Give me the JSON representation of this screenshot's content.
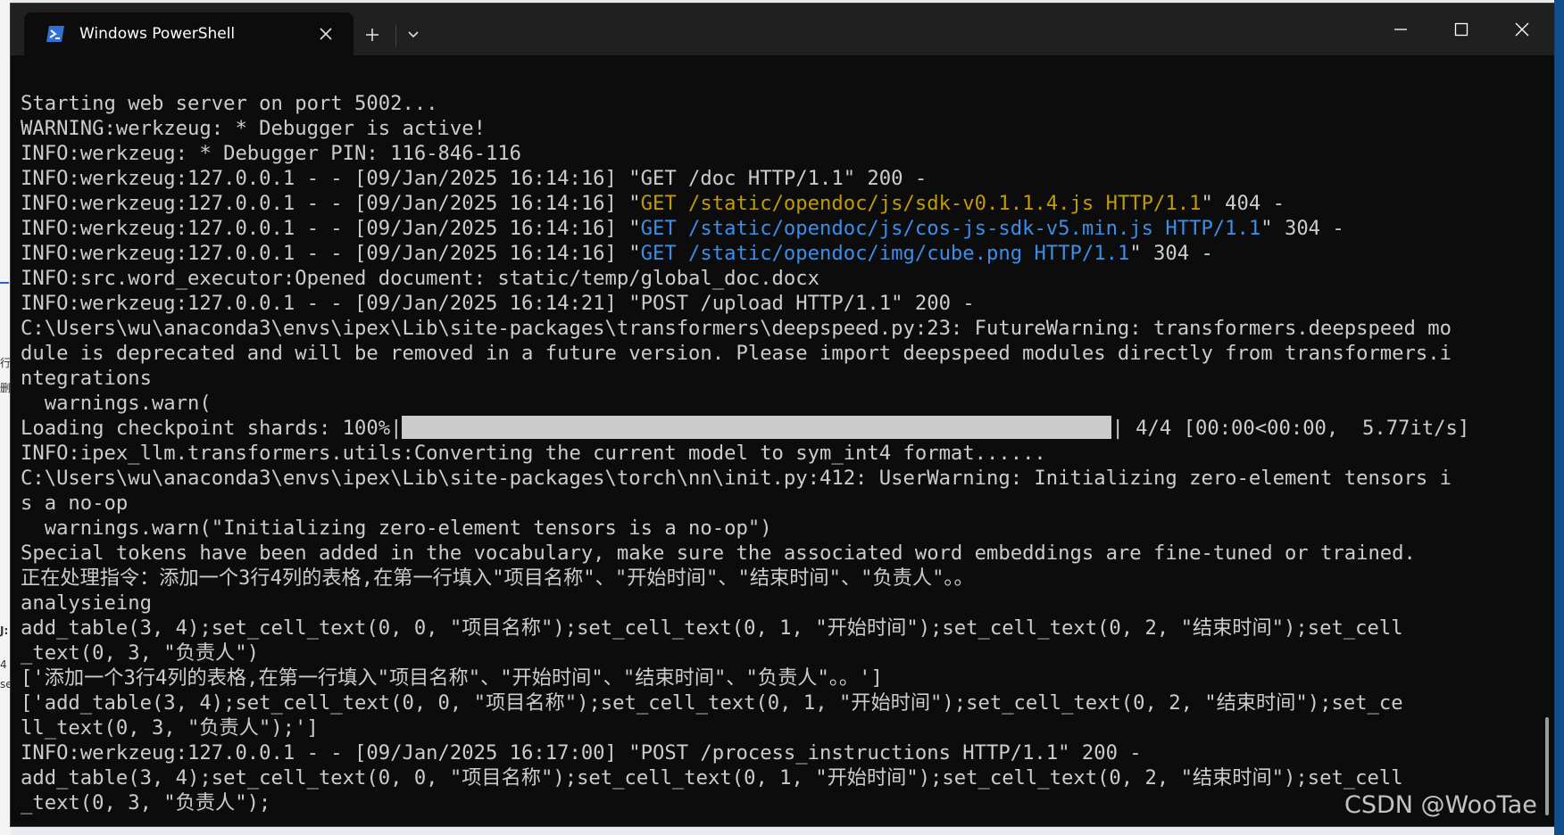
{
  "window": {
    "tab_title": "Windows PowerShell",
    "icons": {
      "tab_icon": "powershell-icon",
      "close_tab": "close-icon",
      "new_tab": "plus-icon",
      "dropdown": "chevron-down-icon",
      "minimize": "minimize-icon",
      "maximize": "maximize-icon",
      "close_window": "close-icon"
    },
    "colors": {
      "terminal_bg": "#0c0c0c",
      "text": "#cccccc",
      "yellow": "#c19c00",
      "blue": "#3b8eea",
      "titlebar": "#202020"
    }
  },
  "terminal": {
    "lines": [
      "Starting web server on port 5002...",
      "WARNING:werkzeug: * Debugger is active!",
      "INFO:werkzeug: * Debugger PIN: 116-846-116",
      "INFO:werkzeug:127.0.0.1 - - [09/Jan/2025 16:14:16] \"GET /doc HTTP/1.1\" 200 -",
      {
        "prefix": "INFO:werkzeug:127.0.0.1 - - [09/Jan/2025 16:14:16] \"",
        "highlight": "GET /static/opendoc/js/sdk-v0.1.1.4.js HTTP/1.1",
        "suffix": "\" 404 -",
        "color": "yellow"
      },
      {
        "prefix": "INFO:werkzeug:127.0.0.1 - - [09/Jan/2025 16:14:16] \"",
        "highlight": "GET /static/opendoc/js/cos-js-sdk-v5.min.js HTTP/1.1",
        "suffix": "\" 304 -",
        "color": "blue"
      },
      {
        "prefix": "INFO:werkzeug:127.0.0.1 - - [09/Jan/2025 16:14:16] \"",
        "highlight": "GET /static/opendoc/img/cube.png HTTP/1.1",
        "suffix": "\" 304 -",
        "color": "blue"
      },
      "INFO:src.word_executor:Opened document: static/temp/global_doc.docx",
      "INFO:werkzeug:127.0.0.1 - - [09/Jan/2025 16:14:21] \"POST /upload HTTP/1.1\" 200 -",
      "C:\\Users\\wu\\anaconda3\\envs\\ipex\\Lib\\site-packages\\transformers\\deepspeed.py:23: FutureWarning: transformers.deepspeed mo",
      "dule is deprecated and will be removed in a future version. Please import deepspeed modules directly from transformers.i",
      "ntegrations",
      "  warnings.warn(",
      {
        "progress_prefix": "Loading checkpoint shards: 100%|",
        "progress": 1.0,
        "progress_suffix": "| 4/4 [00:00<00:00,  5.77it/s]"
      },
      "INFO:ipex_llm.transformers.utils:Converting the current model to sym_int4 format......",
      "C:\\Users\\wu\\anaconda3\\envs\\ipex\\Lib\\site-packages\\torch\\nn\\init.py:412: UserWarning: Initializing zero-element tensors i",
      "s a no-op",
      "  warnings.warn(\"Initializing zero-element tensors is a no-op\")",
      "Special tokens have been added in the vocabulary, make sure the associated word embeddings are fine-tuned or trained.",
      "正在处理指令：添加一个3行4列的表格,在第一行填入\"项目名称\"、\"开始时间\"、\"结束时间\"、\"负责人\"。。",
      "analysieing",
      "add_table(3, 4);set_cell_text(0, 0, \"项目名称\");set_cell_text(0, 1, \"开始时间\");set_cell_text(0, 2, \"结束时间\");set_cell",
      "_text(0, 3, \"负责人\")",
      "['添加一个3行4列的表格,在第一行填入\"项目名称\"、\"开始时间\"、\"结束时间\"、\"负责人\"。。']",
      "['add_table(3, 4);set_cell_text(0, 0, \"项目名称\");set_cell_text(0, 1, \"开始时间\");set_cell_text(0, 2, \"结束时间\");set_ce",
      "ll_text(0, 3, \"负责人\");']",
      "INFO:werkzeug:127.0.0.1 - - [09/Jan/2025 16:17:00] \"POST /process_instructions HTTP/1.1\" 200 -",
      "add_table(3, 4);set_cell_text(0, 0, \"项目名称\");set_cell_text(0, 1, \"开始时间\");set_cell_text(0, 2, \"结束时间\");set_cell",
      "_text(0, 3, \"负责人\");"
    ]
  },
  "desktop": {
    "edge_glyphs": [
      "行",
      "删",
      "4",
      "se",
      "J:"
    ]
  },
  "watermark": "CSDN @WooTae"
}
